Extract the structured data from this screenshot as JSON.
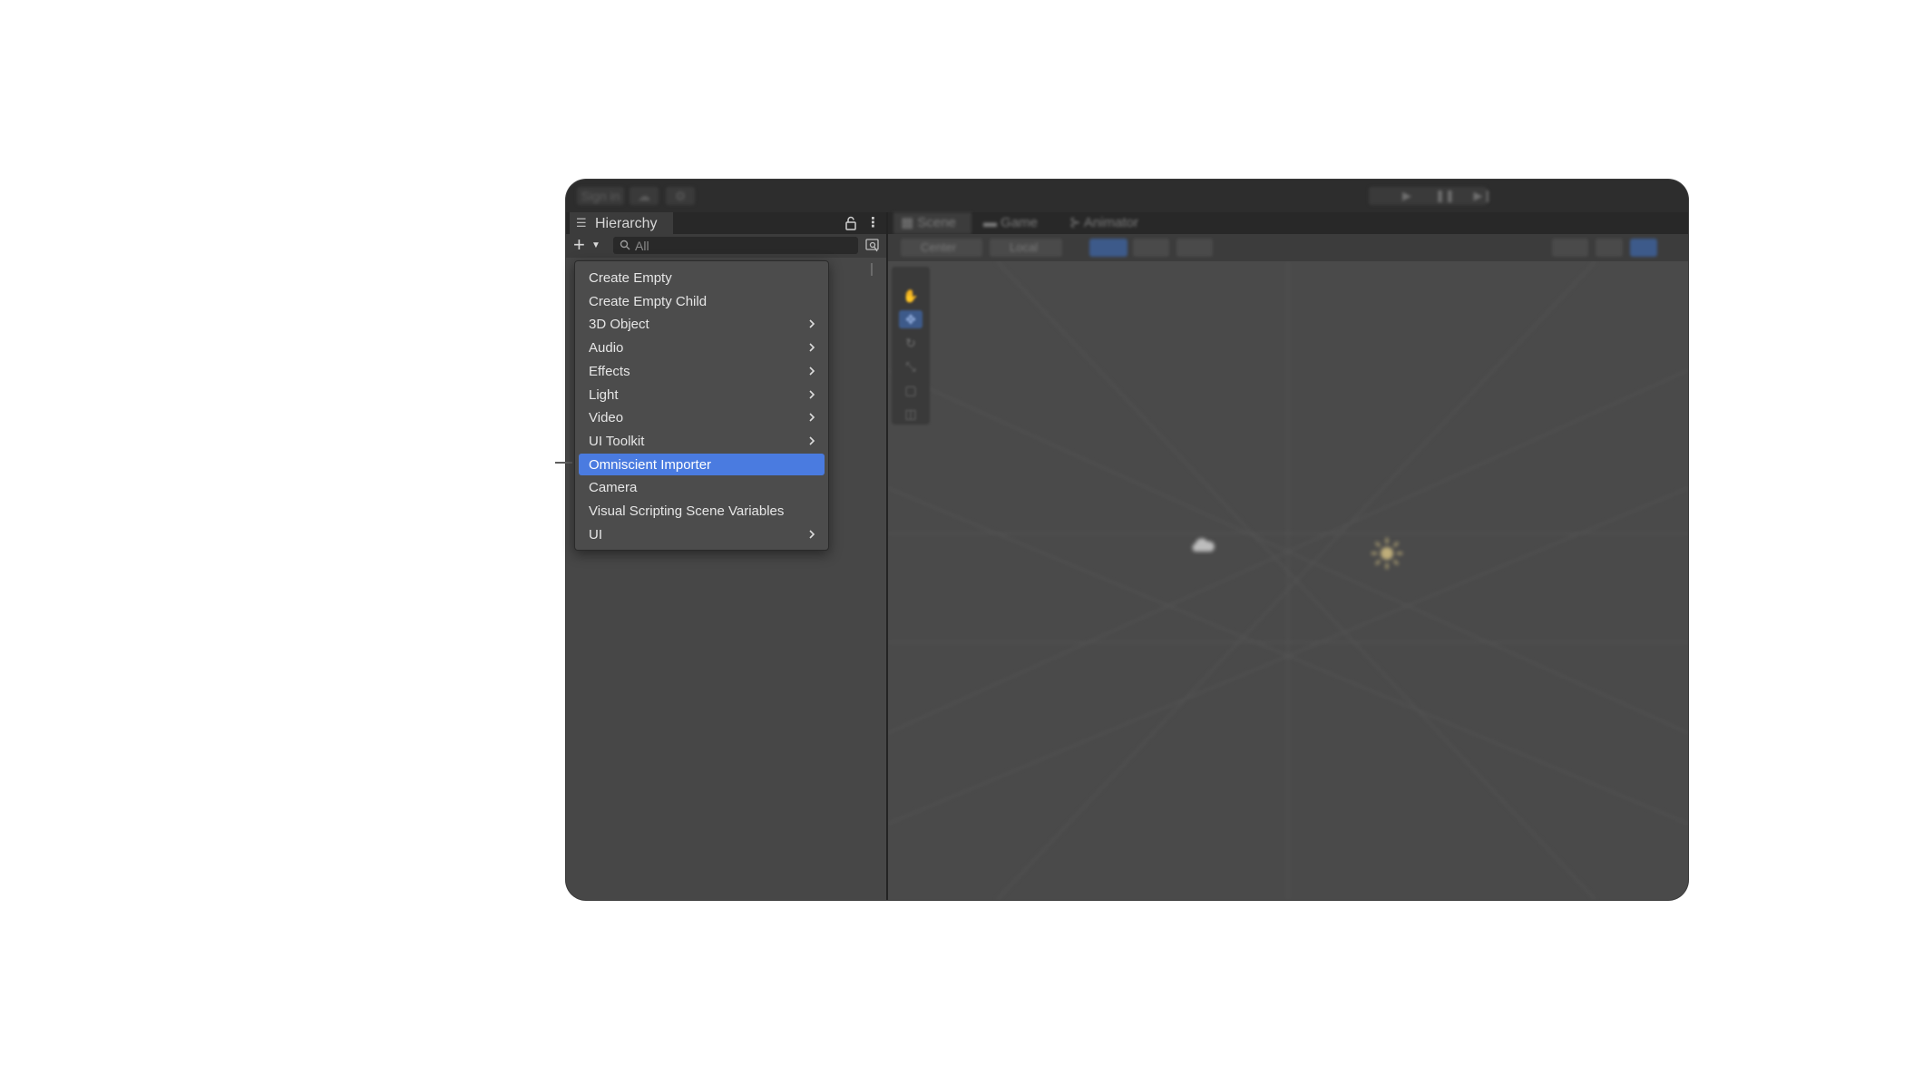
{
  "toolbar": {
    "sign_in_label": "Sign in",
    "cloud_icon": "cloud-icon",
    "services_icon": "services-icon",
    "play_icon": "play-icon",
    "pause_icon": "pause-icon",
    "step_icon": "step-icon"
  },
  "hierarchy": {
    "title": "Hierarchy",
    "search_placeholder": "All",
    "lock_icon": "lock-icon",
    "menu_icon": "kebab-menu-icon"
  },
  "scene": {
    "tabs": [
      {
        "label": "Scene"
      },
      {
        "label": "Game"
      },
      {
        "label": "Animator"
      }
    ],
    "toolbar": {
      "pivot_label": "Center",
      "space_label": "Local"
    }
  },
  "context_menu": {
    "highlight_color": "#4a7be0",
    "items": [
      {
        "label": "Create Empty",
        "submenu": false
      },
      {
        "label": "Create Empty Child",
        "submenu": false
      },
      {
        "label": "3D Object",
        "submenu": true
      },
      {
        "label": "Audio",
        "submenu": true
      },
      {
        "label": "Effects",
        "submenu": true
      },
      {
        "label": "Light",
        "submenu": true
      },
      {
        "label": "Video",
        "submenu": true
      },
      {
        "label": "UI Toolkit",
        "submenu": true
      },
      {
        "label": "Omniscient Importer",
        "submenu": false,
        "highlighted": true
      },
      {
        "label": "Camera",
        "submenu": false
      },
      {
        "label": "Visual Scripting Scene Variables",
        "submenu": false
      },
      {
        "label": "UI",
        "submenu": true
      }
    ]
  }
}
